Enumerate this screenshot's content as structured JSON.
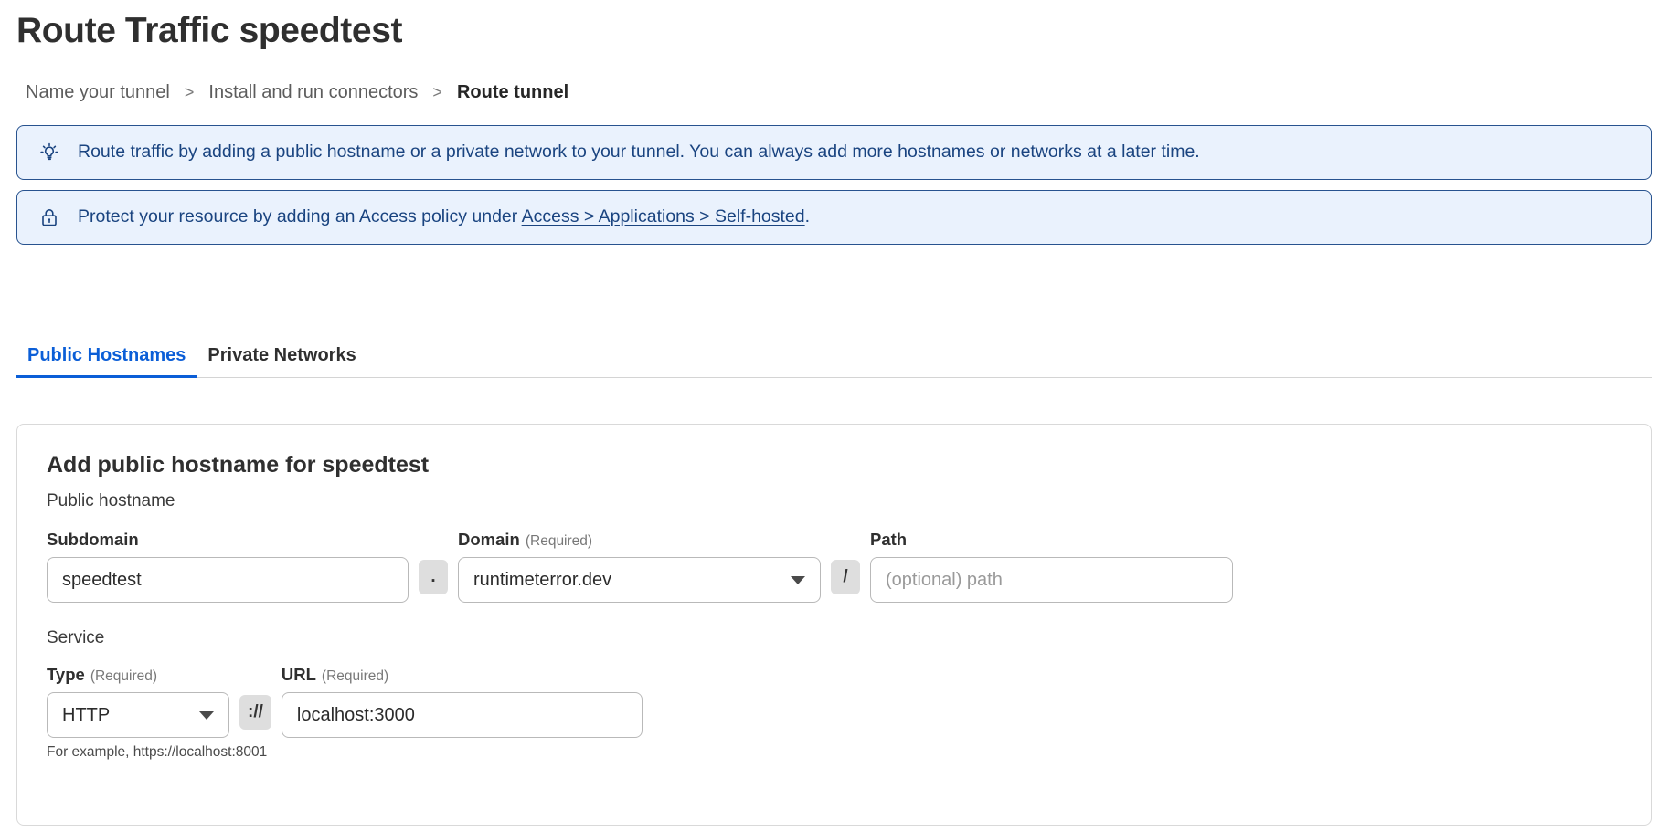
{
  "page": {
    "title": "Route Traffic speedtest"
  },
  "breadcrumb": {
    "separator": ">",
    "items": [
      {
        "label": "Name your tunnel",
        "current": false
      },
      {
        "label": "Install and run connectors",
        "current": false
      },
      {
        "label": "Route tunnel",
        "current": true
      }
    ]
  },
  "banners": [
    {
      "icon": "lightbulb-icon",
      "text": "Route traffic by adding a public hostname or a private network to your tunnel. You can always add more hostnames or networks at a later time."
    },
    {
      "icon": "lock-icon",
      "text_before": "Protect your resource by adding an Access policy under ",
      "link": "Access > Applications > Self-hosted",
      "text_after": "."
    }
  ],
  "tabs": [
    {
      "label": "Public Hostnames",
      "active": true
    },
    {
      "label": "Private Networks",
      "active": false
    }
  ],
  "card": {
    "title": "Add public hostname for speedtest",
    "hostname_section_label": "Public hostname",
    "service_section_label": "Service",
    "fields": {
      "subdomain": {
        "label": "Subdomain",
        "required_note": "",
        "value": "speedtest",
        "placeholder": ""
      },
      "dot_separator": ".",
      "domain": {
        "label": "Domain",
        "required_note": "(Required)",
        "value": "runtimeterror.dev"
      },
      "slash_separator": "/",
      "path": {
        "label": "Path",
        "required_note": "",
        "value": "",
        "placeholder": "(optional) path"
      },
      "type": {
        "label": "Type",
        "required_note": "(Required)",
        "value": "HTTP"
      },
      "scheme_separator": "://",
      "url": {
        "label": "URL",
        "required_note": "(Required)",
        "value": "localhost:3000",
        "placeholder": "",
        "helper": "For example, https://localhost:8001"
      }
    }
  },
  "colors": {
    "accent": "#0b5ed7",
    "banner_bg": "#eaf2fd",
    "banner_border": "#28538f",
    "banner_text": "#1a4480",
    "text": "#2f2f2f"
  }
}
